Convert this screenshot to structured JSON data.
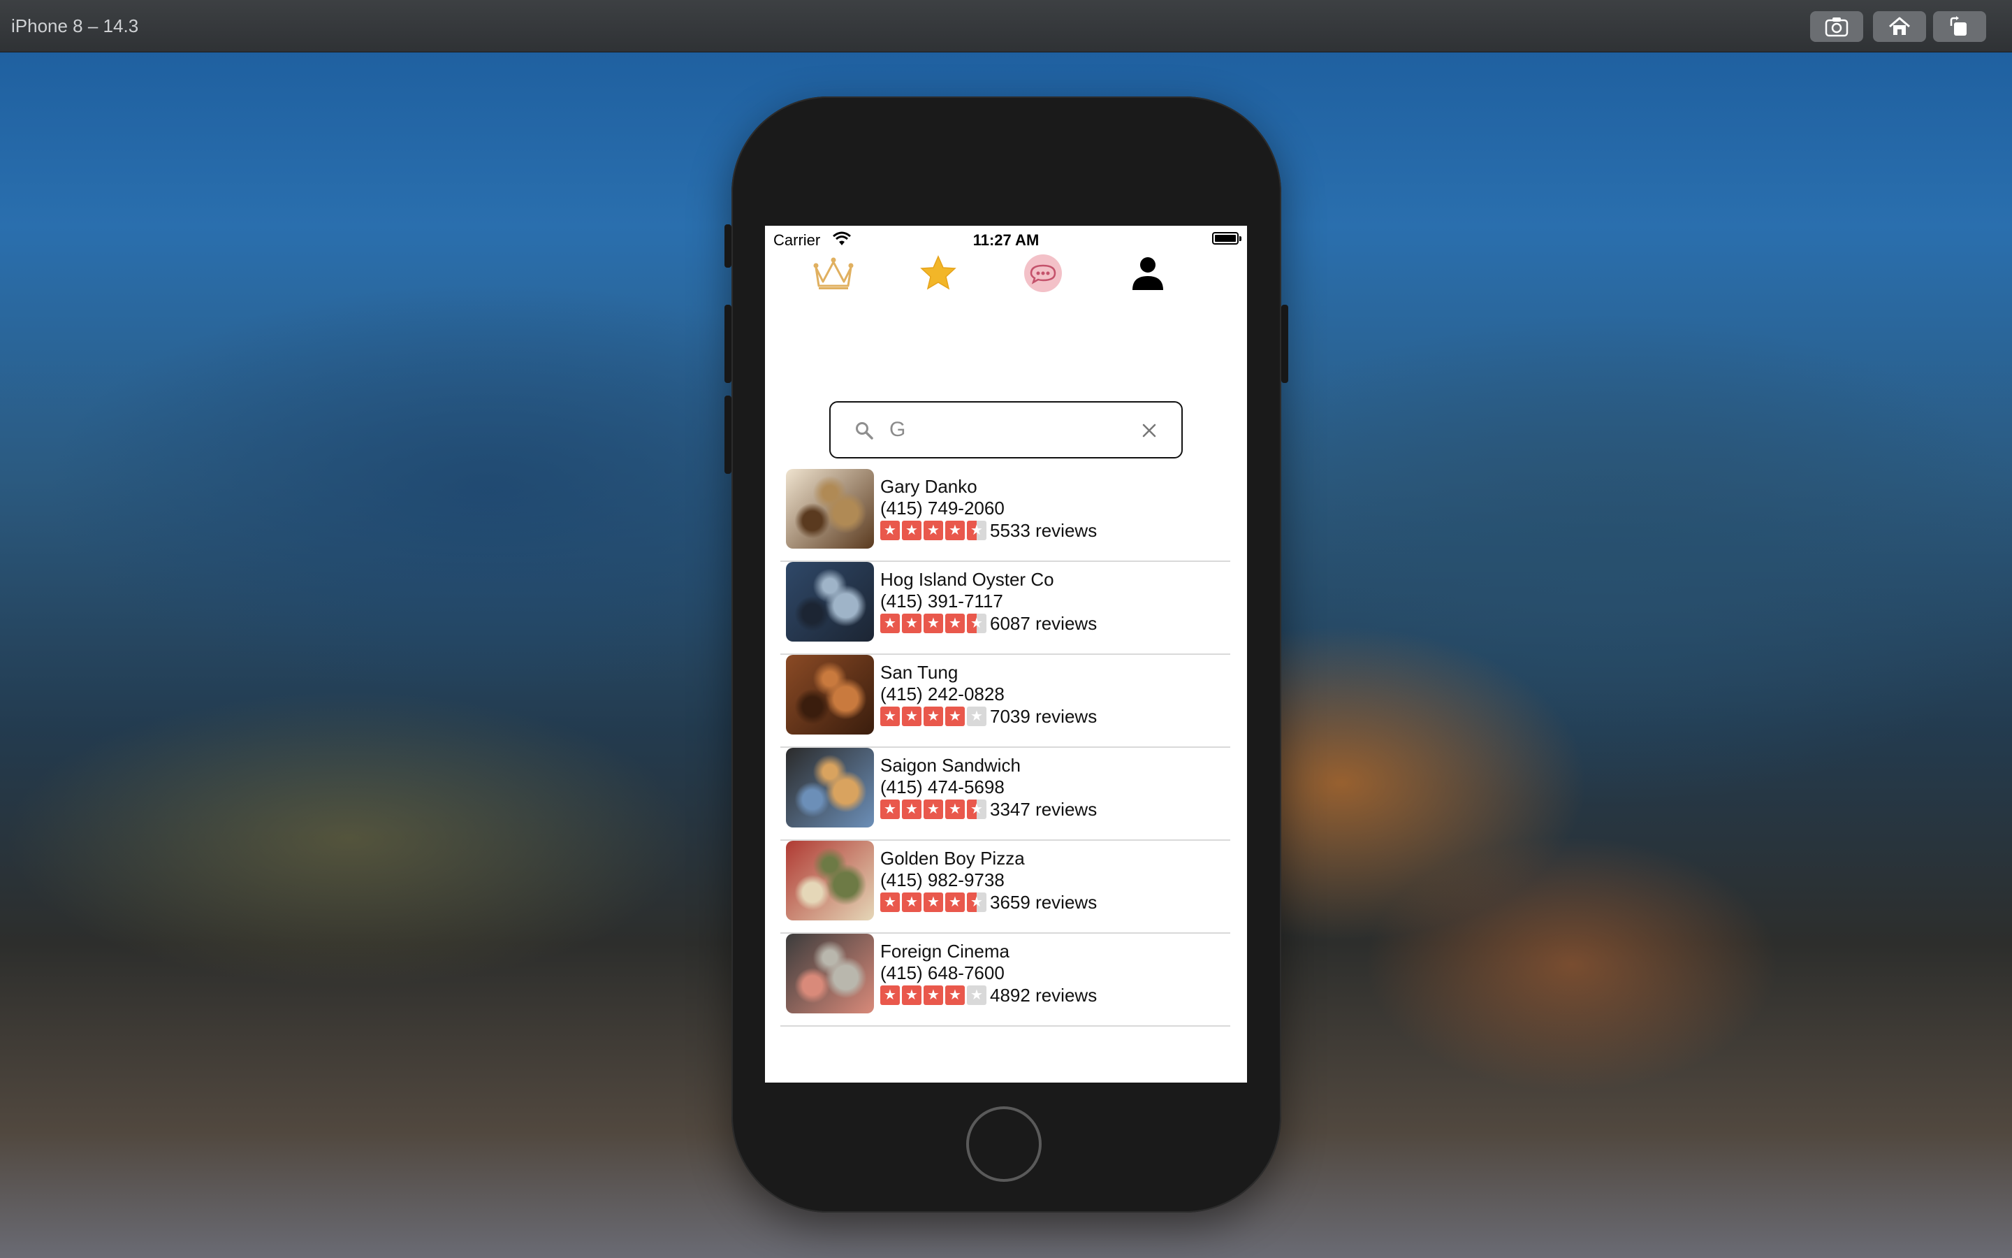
{
  "simulator": {
    "title": "iPhone 8 – 14.3",
    "buttons": [
      "screenshot-icon",
      "home-icon",
      "rotate-icon"
    ]
  },
  "status_bar": {
    "carrier": "Carrier",
    "time": "11:27 AM",
    "battery_level": 1.0
  },
  "tabs": [
    {
      "icon": "crown-icon"
    },
    {
      "icon": "star-icon"
    },
    {
      "icon": "chat-bubble-icon"
    },
    {
      "icon": "person-icon"
    }
  ],
  "search": {
    "value": "G",
    "placeholder": ""
  },
  "colors": {
    "star_on": "#e9584c",
    "star_off": "#d9d9d9",
    "crown": "#e0b060",
    "favorite_star": "#f2b628",
    "chat_badge": "#f3c1c8"
  },
  "restaurants": [
    {
      "name": "Gary Danko",
      "phone": "(415) 749-2060",
      "rating": 4.5,
      "reviews": "5533 reviews",
      "thumb_colors": [
        "#efe3cf",
        "#b08a55",
        "#5a3a1f"
      ]
    },
    {
      "name": "Hog Island Oyster Co",
      "phone": "(415) 391-7117",
      "rating": 4.5,
      "reviews": "6087 reviews",
      "thumb_colors": [
        "#2f4868",
        "#9fb4c8",
        "#1c2533"
      ]
    },
    {
      "name": "San Tung",
      "phone": "(415) 242-0828",
      "rating": 4.0,
      "reviews": "7039 reviews",
      "thumb_colors": [
        "#8a4a25",
        "#c97a3e",
        "#3a1d0d"
      ]
    },
    {
      "name": "Saigon Sandwich",
      "phone": "(415) 474-5698",
      "rating": 4.5,
      "reviews": "3347 reviews",
      "thumb_colors": [
        "#2b2b2b",
        "#d9a35f",
        "#6c8fb8"
      ]
    },
    {
      "name": "Golden Boy Pizza",
      "phone": "(415) 982-9738",
      "rating": 4.5,
      "reviews": "3659 reviews",
      "thumb_colors": [
        "#b03a33",
        "#6d7a45",
        "#e5d7b8"
      ]
    },
    {
      "name": "Foreign Cinema",
      "phone": "(415) 648-7600",
      "rating": 4.0,
      "reviews": "4892 reviews",
      "thumb_colors": [
        "#3c3c3c",
        "#b9b7ad",
        "#d98a7a"
      ]
    }
  ]
}
